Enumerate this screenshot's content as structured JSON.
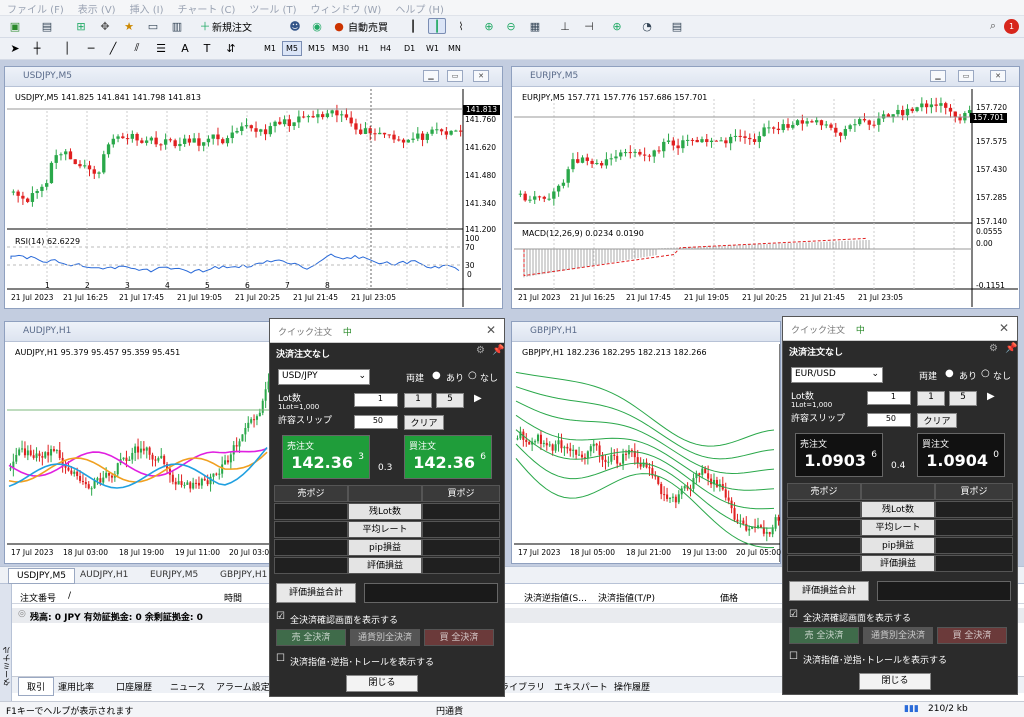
{
  "menu": [
    "ファイル (F)",
    "表示 (V)",
    "挿入 (I)",
    "チャート (C)",
    "ツール (T)",
    "ウィンドウ (W)",
    "ヘルプ (H)"
  ],
  "toolbar": {
    "new_order": "新規注文",
    "auto_trade": "自動売買",
    "notify_count": "1",
    "timeframes": [
      "M1",
      "M5",
      "M15",
      "M30",
      "H1",
      "H4",
      "D1",
      "W1",
      "MN"
    ],
    "active_tf": "M5",
    "draw_letters": [
      "A",
      "T"
    ]
  },
  "charts": {
    "usdjpy": {
      "title": "USDJPY,M5",
      "info": "USDJPY,M5 141.825 141.841 141.798 141.813",
      "price": "141.813",
      "yticks": [
        "141.760",
        "141.620",
        "141.480",
        "141.340",
        "141.200"
      ],
      "osc_label": "RSI(14) 62.6229",
      "osc_ticks": [
        "100",
        "70",
        "30",
        "0"
      ],
      "xticks": [
        "21 Jul 2023",
        "21 Jul 16:25",
        "21 Jul 17:45",
        "21 Jul 19:05",
        "21 Jul 20:25",
        "21 Jul 21:45",
        "21 Jul 23:05"
      ],
      "markers": [
        "1",
        "2",
        "3",
        "4",
        "5",
        "6",
        "7",
        "8"
      ]
    },
    "eurjpy": {
      "title": "EURJPY,M5",
      "info": "EURJPY,M5 157.771 157.776 157.686 157.701",
      "price": "157.701",
      "yticks": [
        "157.720",
        "157.575",
        "157.430",
        "157.285",
        "157.140"
      ],
      "osc_label": "MACD(12,26,9) 0.0234 0.0190",
      "osc_ticks": [
        "0.0555",
        "0.00",
        "-0.1151"
      ],
      "xticks": [
        "21 Jul 2023",
        "21 Jul 16:25",
        "21 Jul 17:45",
        "21 Jul 19:05",
        "21 Jul 20:25",
        "21 Jul 21:45",
        "21 Jul 23:05"
      ]
    },
    "audjpy": {
      "title": "AUDJPY,H1",
      "info": "AUDJPY,H1 95.379 95.457 95.359 95.451",
      "xticks": [
        "17 Jul 2023",
        "18 Jul 03:00",
        "18 Jul 19:00",
        "19 Jul 11:00",
        "20 Jul 03:00"
      ]
    },
    "gbpjpy": {
      "title": "GBPJPY,H1",
      "info": "GBPJPY,H1 182.236 182.295 182.213 182.266",
      "xticks": [
        "17 Jul 2023",
        "18 Jul 05:00",
        "18 Jul 21:00",
        "19 Jul 13:00",
        "20 Jul 05:00"
      ]
    }
  },
  "chart_tabs": [
    "USDJPY,M5",
    "AUDJPY,H1",
    "EURJPY,M5",
    "GBPJPY,H1"
  ],
  "terminal": {
    "cols": [
      "注文番号",
      "/",
      "時間",
      "決済逆指値(S...",
      "決済指値(T/P)",
      "価格"
    ],
    "balance": "残高: 0 JPY  有効証拠金: 0  余剰証拠金: 0",
    "side_label": "ターミナル",
    "tabs": [
      "取引",
      "運用比率",
      "口座履歴",
      "ニュース",
      "アラーム設定",
      "ライブラリ",
      "エキスパート",
      "操作履歴"
    ]
  },
  "status": {
    "help": "F1キーでヘルプが表示されます",
    "currency": "円通貨",
    "traffic": "210/2 kb"
  },
  "quick_orders": [
    {
      "title": "クイック注文",
      "pin": "中",
      "subtitle": "決済注文なし",
      "symbol": "USD/JPY",
      "ryodate": "両建",
      "opt_yes": "あり",
      "opt_no": "なし",
      "lot_label": "Lot数",
      "lot_unit": "1Lot=1,000",
      "lot_value": "1",
      "btn1": "1",
      "btn5": "5",
      "slip_label": "許容スリップ",
      "slip_value": "50",
      "clear": "クリア",
      "sell_label": "売注文",
      "sell_big": "142.36",
      "sell_small": "3",
      "spread": "0.3",
      "buy_label": "買注文",
      "buy_big": "142.36",
      "buy_small": "6",
      "pos_sell": "売ポジ",
      "pos_buy": "買ポジ",
      "rows": [
        "残Lot数",
        "平均レート",
        "pip損益",
        "評価損益"
      ],
      "total": "評価損益合計",
      "confirm": "全決済確認画面を表示する",
      "btn_sell_all": "売 全決済",
      "btn_pair_all": "通貨別全決済",
      "btn_buy_all": "買 全決済",
      "show_stops": "決済指値･逆指･トレールを表示する",
      "close": "閉じる"
    },
    {
      "title": "クイック注文",
      "pin": "中",
      "subtitle": "決済注文なし",
      "symbol": "EUR/USD",
      "ryodate": "両建",
      "opt_yes": "あり",
      "opt_no": "なし",
      "lot_label": "Lot数",
      "lot_unit": "1Lot=1,000",
      "lot_value": "1",
      "btn1": "1",
      "btn5": "5",
      "slip_label": "許容スリップ",
      "slip_value": "50",
      "clear": "クリア",
      "sell_label": "売注文",
      "sell_big": "1.0903",
      "sell_small": "6",
      "spread": "0.4",
      "buy_label": "買注文",
      "buy_big": "1.0904",
      "buy_small": "0",
      "pos_sell": "売ポジ",
      "pos_buy": "買ポジ",
      "rows": [
        "残Lot数",
        "平均レート",
        "pip損益",
        "評価損益"
      ],
      "total": "評価損益合計",
      "confirm": "全決済確認画面を表示する",
      "btn_sell_all": "売 全決済",
      "btn_pair_all": "通貨別全決済",
      "btn_buy_all": "買 全決済",
      "show_stops": "決済指値･逆指･トレールを表示する",
      "close": "閉じる"
    }
  ],
  "colors": {
    "bull": "#2aa84a",
    "bear": "#e02020",
    "buy_green": "#1f9d3a",
    "accent": "#2a6ad8"
  }
}
